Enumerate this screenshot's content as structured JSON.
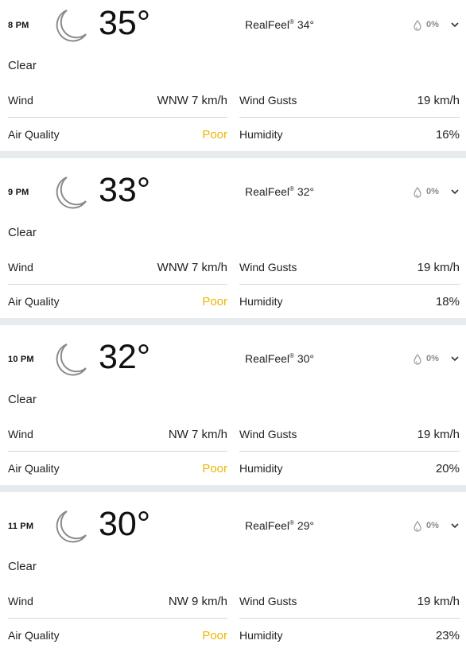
{
  "hours": [
    {
      "time": "8 PM",
      "temp": "35°",
      "realfeel_label": "RealFeel",
      "realfeel_mark": "®",
      "realfeel_value": "34°",
      "precip": "0%",
      "condition": "Clear",
      "wind_label": "Wind",
      "wind": "WNW 7 km/h",
      "gusts_label": "Wind Gusts",
      "gusts": "19 km/h",
      "aq_label": "Air Quality",
      "aq": "Poor",
      "humidity_label": "Humidity",
      "humidity": "16%"
    },
    {
      "time": "9 PM",
      "temp": "33°",
      "realfeel_label": "RealFeel",
      "realfeel_mark": "®",
      "realfeel_value": "32°",
      "precip": "0%",
      "condition": "Clear",
      "wind_label": "Wind",
      "wind": "WNW 7 km/h",
      "gusts_label": "Wind Gusts",
      "gusts": "19 km/h",
      "aq_label": "Air Quality",
      "aq": "Poor",
      "humidity_label": "Humidity",
      "humidity": "18%"
    },
    {
      "time": "10 PM",
      "temp": "32°",
      "realfeel_label": "RealFeel",
      "realfeel_mark": "®",
      "realfeel_value": "30°",
      "precip": "0%",
      "condition": "Clear",
      "wind_label": "Wind",
      "wind": "NW 7 km/h",
      "gusts_label": "Wind Gusts",
      "gusts": "19 km/h",
      "aq_label": "Air Quality",
      "aq": "Poor",
      "humidity_label": "Humidity",
      "humidity": "20%"
    },
    {
      "time": "11 PM",
      "temp": "30°",
      "realfeel_label": "RealFeel",
      "realfeel_mark": "®",
      "realfeel_value": "29°",
      "precip": "0%",
      "condition": "Clear",
      "wind_label": "Wind",
      "wind": "NW 9 km/h",
      "gusts_label": "Wind Gusts",
      "gusts": "19 km/h",
      "aq_label": "Air Quality",
      "aq": "Poor",
      "humidity_label": "Humidity",
      "humidity": "23%"
    }
  ],
  "icons": {
    "condition": "moon-icon",
    "precip": "raindrop-icon",
    "expand": "chevron-down-icon"
  },
  "colors": {
    "poor": "#f0b400",
    "separator": "#e8ebee",
    "divider": "#d6d6d6",
    "precip": "#888888"
  }
}
